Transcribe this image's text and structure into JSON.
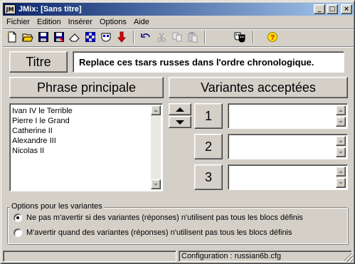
{
  "window": {
    "app_icon_text": "JM",
    "title": "JMix: [Sans titre]",
    "minimize_glyph": "_",
    "maximize_glyph": "□",
    "close_glyph": "×"
  },
  "menu": {
    "items": [
      {
        "label": "Fichier"
      },
      {
        "label": "Edition"
      },
      {
        "label": "Insérer"
      },
      {
        "label": "Options"
      },
      {
        "label": "Aide"
      }
    ]
  },
  "toolbar": {
    "icons": [
      "new-icon",
      "open-icon",
      "save-icon",
      "save-as-icon",
      "eraser-icon",
      "checkers-icon",
      "mask-icon",
      "arrow-down-red-icon",
      "undo-icon",
      "cut-icon",
      "copy-icon",
      "paste-icon",
      "theater-masks-icon",
      "help-icon"
    ]
  },
  "title_section": {
    "label": "Titre",
    "value": "Replace ces tsars russes dans l'ordre chronologique."
  },
  "main_phrase": {
    "label": "Phrase principale",
    "items": [
      "Ivan IV le Terrible",
      "Pierre I le Grand",
      "Catherine II",
      "Alexandre III",
      "Nicolas II"
    ]
  },
  "variants": {
    "label": "Variantes acceptées",
    "buttons": [
      "1",
      "2",
      "3"
    ],
    "values": [
      "",
      "",
      ""
    ]
  },
  "options": {
    "legend": "Options pour les variantes",
    "radio1": "Ne pas m'avertir si des variantes (réponses) n'utilisent pas tous les blocs définis",
    "radio2": "M'avertir quand des variantes (réponses) n'utilisent pas tous les blocs définis",
    "selected": 1
  },
  "statusbar": {
    "config": "Configuration : russian6b.cfg"
  },
  "colors": {
    "face": "#d4d0c8",
    "title_start": "#0a246a",
    "title_end": "#a6caf0"
  }
}
